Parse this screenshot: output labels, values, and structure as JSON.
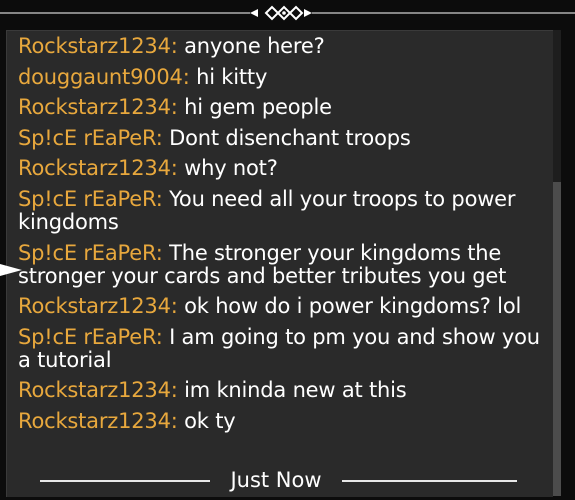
{
  "chat": {
    "messages": [
      {
        "user": "Rockstarz1234:",
        "text": "anyone here?"
      },
      {
        "user": "douggaunt9004:",
        "text": "hi   kitty"
      },
      {
        "user": "Rockstarz1234:",
        "text": "hi gem people"
      },
      {
        "user": "Sp!cE rEaPeR:",
        "text": "Dont disenchant troops"
      },
      {
        "user": "Rockstarz1234:",
        "text": "why not?"
      },
      {
        "user": "Sp!cE rEaPeR:",
        "text": "You need all your troops to power kingdoms"
      },
      {
        "user": "Sp!cE rEaPeR:",
        "text": "The stronger your kingdoms the stronger your cards and better tributes you get"
      },
      {
        "user": "Rockstarz1234:",
        "text": "ok how do i power kingdoms? lol"
      },
      {
        "user": "Sp!cE rEaPeR:",
        "text": "I am going to pm you and show you a tutorial"
      },
      {
        "user": "Rockstarz1234:",
        "text": "im kninda new at this"
      },
      {
        "user": "Rockstarz1234:",
        "text": "ok ty"
      }
    ],
    "timestamp": "Just Now"
  },
  "colors": {
    "username": "#e8a83d",
    "message_text": "#ffffff",
    "panel_bg": "#2a2a2a"
  },
  "icons": {
    "ornament": "diamond-ornament-icon",
    "pointer": "pointer-arrow-icon"
  }
}
